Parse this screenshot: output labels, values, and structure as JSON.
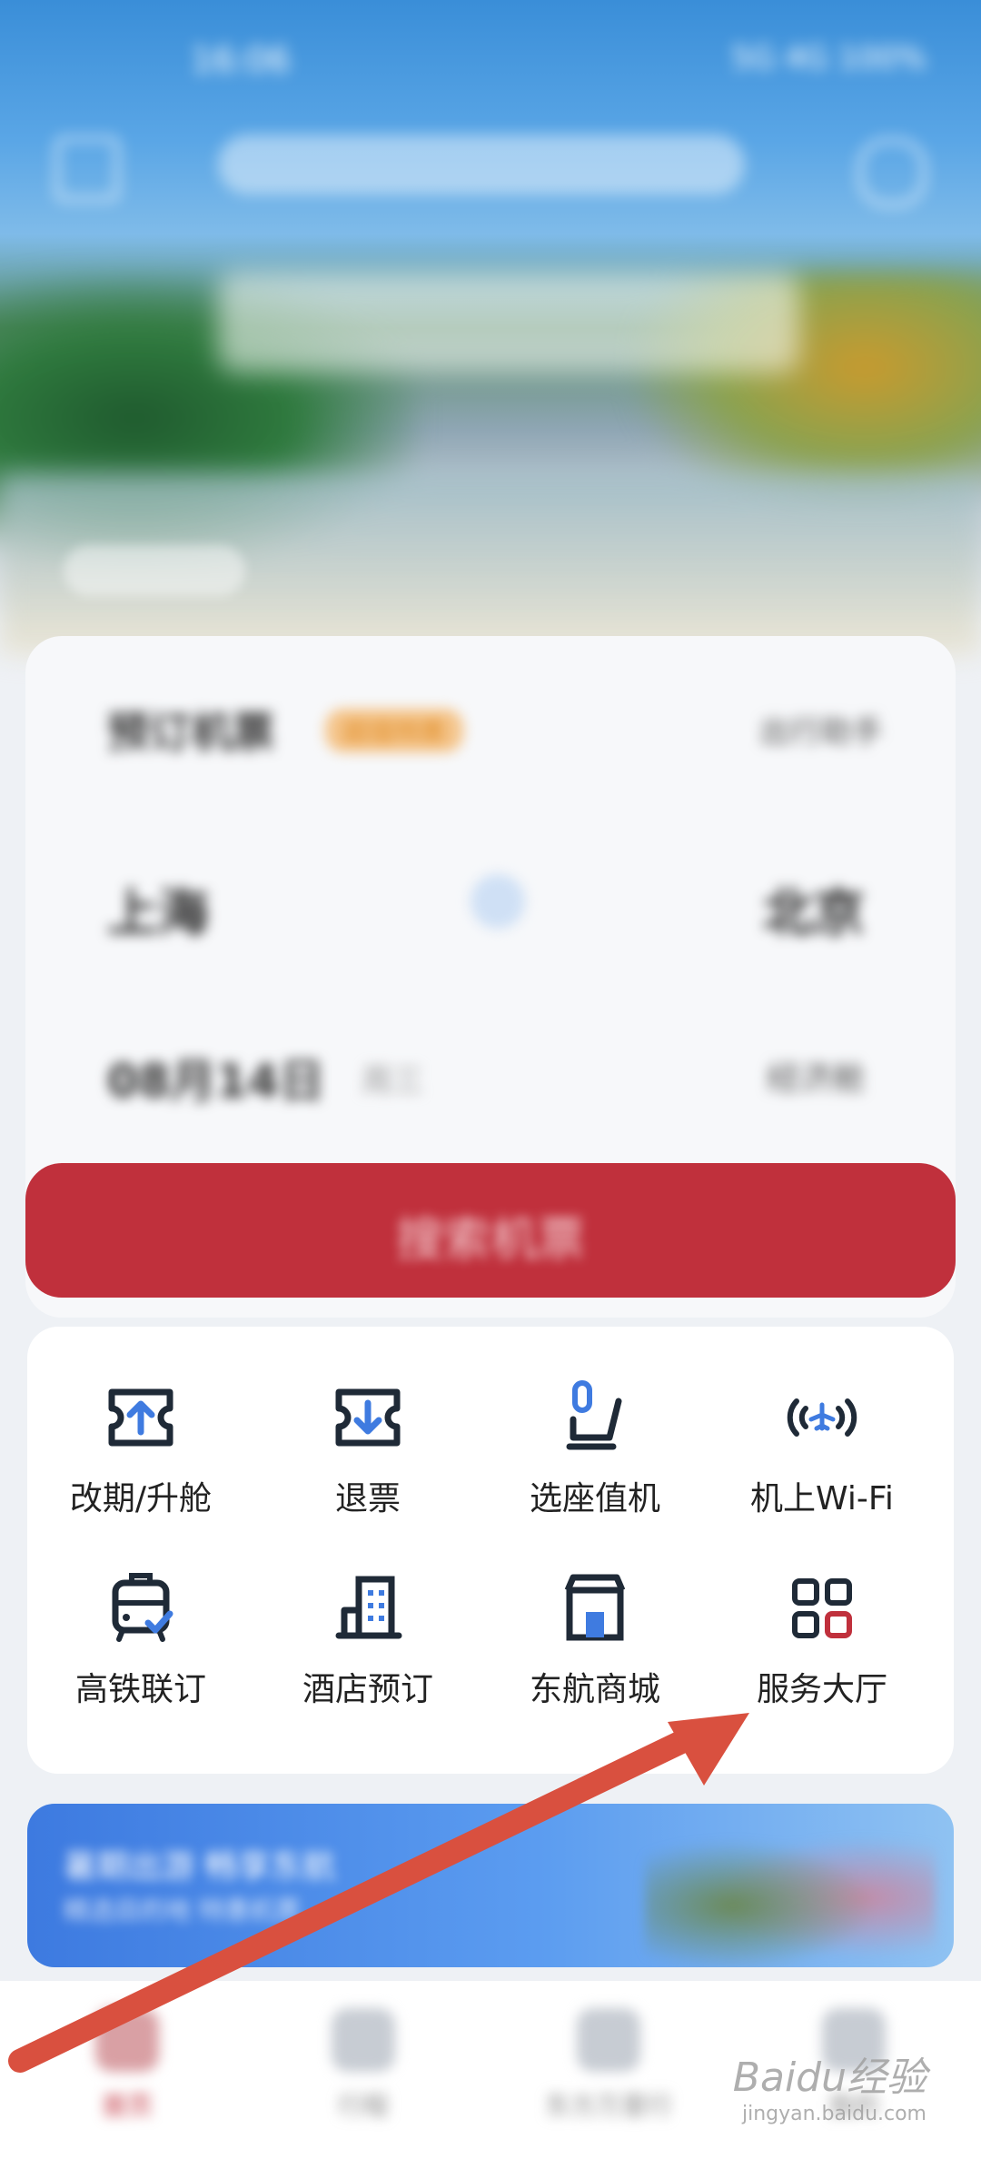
{
  "status_bar": {
    "time": "16:06",
    "icons": "5G 4G 100%"
  },
  "booking": {
    "title": "预订机票",
    "badge": "超值特惠",
    "right_link": "出行助手",
    "from_city": "上海",
    "to_city": "北京",
    "date": "08月14日",
    "date_sub": "周三",
    "cabin": "经济舱",
    "search_button": "搜索机票"
  },
  "services": {
    "items": [
      {
        "label": "改期/升舱",
        "icon": "ticket-up-icon"
      },
      {
        "label": "退票",
        "icon": "ticket-down-icon"
      },
      {
        "label": "选座值机",
        "icon": "seat-icon"
      },
      {
        "label": "机上Wi-Fi",
        "icon": "plane-wifi-icon"
      },
      {
        "label": "高铁联订",
        "icon": "train-icon"
      },
      {
        "label": "酒店预订",
        "icon": "hotel-icon"
      },
      {
        "label": "东航商城",
        "icon": "store-icon"
      },
      {
        "label": "服务大厅",
        "icon": "grid-icon"
      }
    ]
  },
  "promo": {
    "title": "暑期出游 畅享东航",
    "subtitle": "精选目的地 特惠机票"
  },
  "bottom_nav": {
    "items": [
      {
        "label": "首页",
        "active": true
      },
      {
        "label": "行程"
      },
      {
        "label": "东方万里行"
      },
      {
        "label": "我的"
      }
    ]
  },
  "watermark": {
    "main": "Baidu经验",
    "sub": "jingyan.baidu.com"
  },
  "colors": {
    "accent_red": "#c0303c",
    "icon_blue": "#3f7be0",
    "icon_dark": "#1f2a37",
    "arrow": "#d9503f"
  }
}
